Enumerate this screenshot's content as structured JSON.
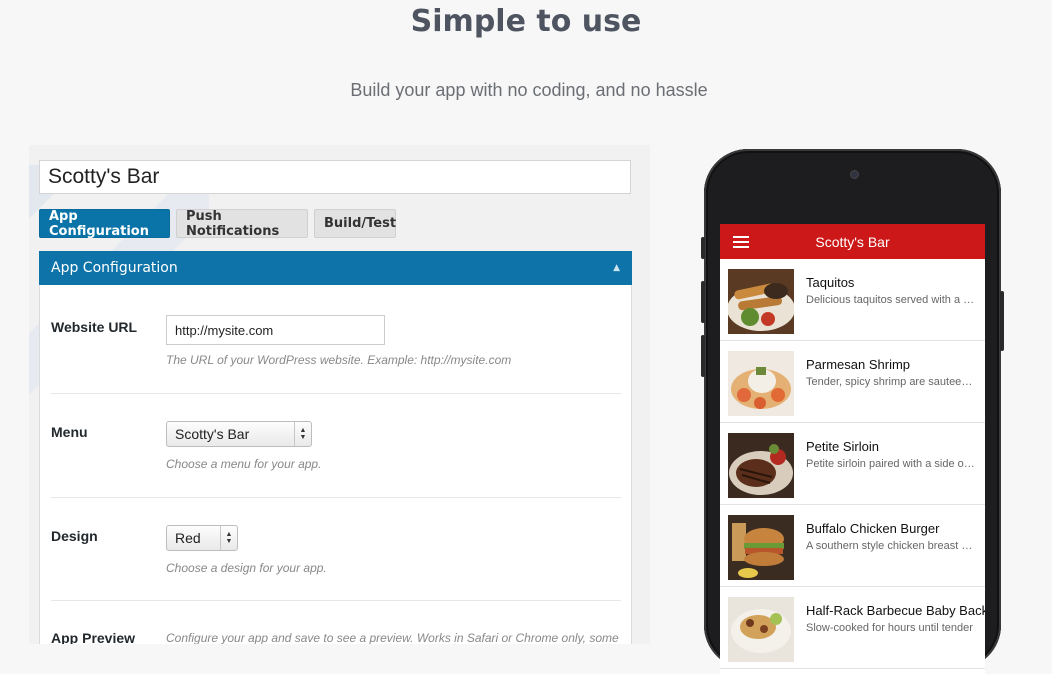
{
  "hero": {
    "title": "Simple to use",
    "subtitle": "Build your app with no coding, and no hassle"
  },
  "admin": {
    "app_name": "Scotty's Bar",
    "tabs": [
      {
        "label": "App Configuration",
        "active": true
      },
      {
        "label": "Push Notifications",
        "active": false
      },
      {
        "label": "Build/Test",
        "active": false
      }
    ],
    "section_title": "App Configuration",
    "rows": {
      "website_url": {
        "label": "Website URL",
        "value": "http://mysite.com",
        "hint": "The URL of your WordPress website. Example: http://mysite.com"
      },
      "menu": {
        "label": "Menu",
        "value": "Scotty's Bar",
        "hint": "Choose a menu for your app."
      },
      "design": {
        "label": "Design",
        "value": "Red",
        "hint": "Choose a design for your app."
      },
      "preview": {
        "label": "App Preview",
        "hint": "Configure your app and save to see a preview. Works in Safari or Chrome only, some"
      }
    }
  },
  "phone": {
    "app_title": "Scotty's Bar",
    "accent": "#cc1818",
    "items": [
      {
        "title": "Taquitos",
        "desc": "Delicious taquitos served with a side of fresh salsa"
      },
      {
        "title": "Parmesan Shrimp",
        "desc": "Tender, spicy shrimp are sauteed in garlic butter"
      },
      {
        "title": "Petite Sirloin",
        "desc": "Petite sirloin paired with a side of vegetables"
      },
      {
        "title": "Buffalo Chicken Burger",
        "desc": "A southern style chicken breast sandwich"
      },
      {
        "title": "Half-Rack Barbecue Baby Back Ribs",
        "desc": "Slow-cooked for hours until tender"
      }
    ]
  }
}
